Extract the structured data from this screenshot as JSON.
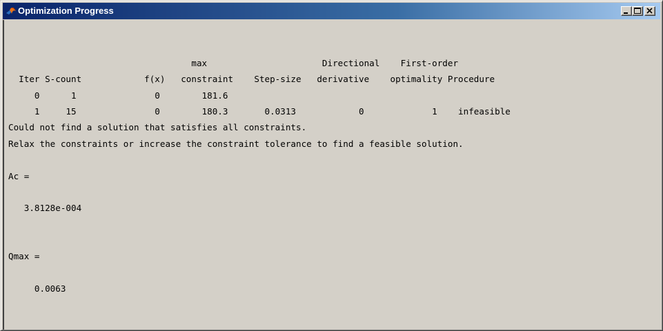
{
  "window": {
    "title": "Optimization Progress",
    "title_bar_color": "#0a246a",
    "icon": "matlab-icon",
    "buttons": [
      "minimize-icon",
      "maximize-icon",
      "close-icon"
    ]
  },
  "console": {
    "lines": [
      "",
      "",
      "                                   max                      Directional    First-order",
      "  Iter S-count            f(x)   constraint    Step-size   derivative    optimality Procedure",
      "     0      1               0        181.6",
      "     1     15               0        180.3       0.0313            0             1    infeasible",
      "Could not find a solution that satisfies all constraints.",
      "Relax the constraints or increase the constraint tolerance to find a feasible solution.",
      "",
      "Ac =",
      "",
      "   3.8128e-004",
      "",
      "",
      "Qmax =",
      "",
      "     0.0063",
      "",
      ""
    ]
  }
}
